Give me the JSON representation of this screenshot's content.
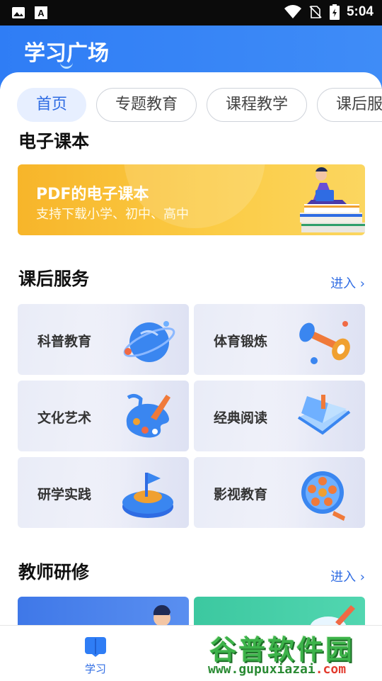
{
  "status_bar": {
    "time": "5:04",
    "icons": [
      "image-icon",
      "font-icon",
      "wifi-icon",
      "no-sim-icon",
      "battery-icon"
    ]
  },
  "header": {
    "title": "学习广场"
  },
  "tabs": [
    {
      "label": "首页",
      "active": true
    },
    {
      "label": "专题教育",
      "active": false
    },
    {
      "label": "课程教学",
      "active": false
    },
    {
      "label": "课后服务",
      "active": false
    }
  ],
  "textbook": {
    "title": "电子课本",
    "banner_title": "PDF的电子课本",
    "banner_subtitle": "支持下载小学、初中、高中"
  },
  "after_school": {
    "title": "课后服务",
    "enter_label": "进入 ›",
    "items": [
      {
        "label": "科普教育",
        "icon": "globe-icon"
      },
      {
        "label": "体育锻炼",
        "icon": "dumbbell-icon"
      },
      {
        "label": "文化艺术",
        "icon": "palette-icon"
      },
      {
        "label": "经典阅读",
        "icon": "book-icon"
      },
      {
        "label": "研学实践",
        "icon": "flag-platform-icon"
      },
      {
        "label": "影视教育",
        "icon": "film-reel-icon"
      }
    ]
  },
  "teacher_training": {
    "title": "教师研修",
    "enter_label": "进入 ›"
  },
  "bottom_nav": {
    "items": [
      {
        "label": "学习",
        "icon": "book-open-icon",
        "active": true
      }
    ]
  },
  "watermark": {
    "main": "谷普软件园",
    "url_a": "www.gupuxiazai",
    "url_b": ".com"
  },
  "colors": {
    "brand_blue": "#2f7df5",
    "tab_active_text": "#2f6ce3",
    "banner_yellow": "#f7b52a",
    "teacher_card_blue": "#3f78e8",
    "teacher_card_green": "#3cc8a0"
  }
}
